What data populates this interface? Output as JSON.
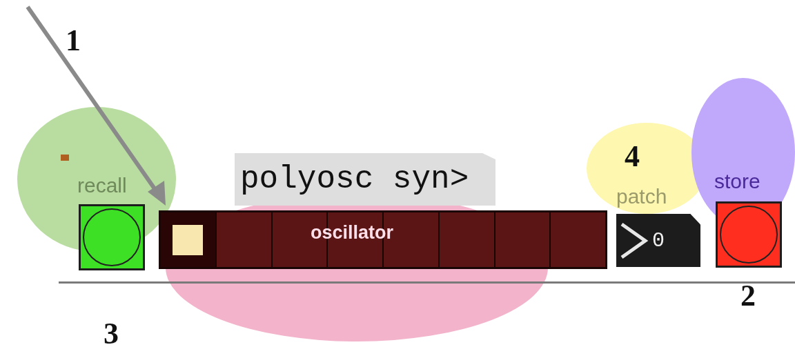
{
  "patch": {
    "recall": {
      "label": "recall",
      "color": "#3ee026"
    },
    "message": {
      "text": "polyosc syn>"
    },
    "selector": {
      "label": "oscillator",
      "segments": [
        {
          "selected": true
        },
        {
          "selected": false
        },
        {
          "selected": false
        },
        {
          "selected": false
        },
        {
          "selected": false
        },
        {
          "selected": false
        },
        {
          "selected": false
        },
        {
          "selected": false
        }
      ]
    },
    "number": {
      "label": "patch",
      "value": "0"
    },
    "store": {
      "label": "store",
      "color": "#ff2e1f"
    }
  },
  "highlights": [
    {
      "color": "#b9dda0"
    },
    {
      "color": "#f3b3cb"
    },
    {
      "color": "#fdf7b0"
    },
    {
      "color": "#c0a8fa"
    }
  ],
  "callouts": [
    {
      "label": "1"
    },
    {
      "label": "2"
    },
    {
      "label": "3"
    },
    {
      "label": "4"
    }
  ]
}
